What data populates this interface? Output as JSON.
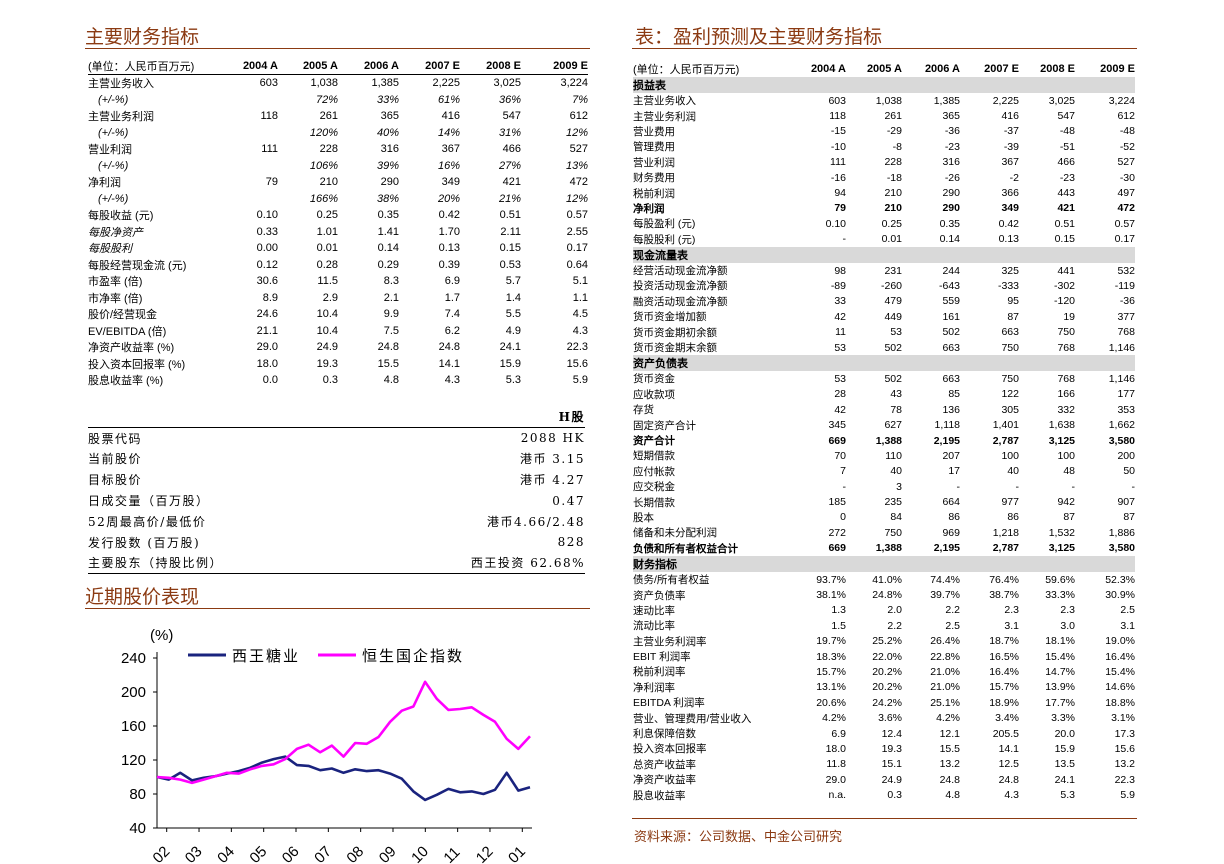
{
  "left": {
    "title": "主要财务指标",
    "table": {
      "unit": "(单位：人民币百万元)",
      "years": [
        "2004 A",
        "2005 A",
        "2006 A",
        "2007 E",
        "2008 E",
        "2009 E"
      ],
      "rows": [
        {
          "label": "主营业务收入",
          "values": [
            "603",
            "1,038",
            "1,385",
            "2,225",
            "3,025",
            "3,224"
          ]
        },
        {
          "label": "(+/-%)",
          "values": [
            "",
            "72%",
            "33%",
            "61%",
            "36%",
            "7%"
          ]
        },
        {
          "label": "主营业务利润",
          "values": [
            "118",
            "261",
            "365",
            "416",
            "547",
            "612"
          ]
        },
        {
          "label": "(+/-%)",
          "values": [
            "",
            "120%",
            "40%",
            "14%",
            "31%",
            "12%"
          ]
        },
        {
          "label": "营业利润",
          "values": [
            "111",
            "228",
            "316",
            "367",
            "466",
            "527"
          ]
        },
        {
          "label": "(+/-%)",
          "values": [
            "",
            "106%",
            "39%",
            "16%",
            "27%",
            "13%"
          ]
        },
        {
          "label": "净利润",
          "values": [
            "79",
            "210",
            "290",
            "349",
            "421",
            "472"
          ]
        },
        {
          "label": "(+/-%)",
          "values": [
            "",
            "166%",
            "38%",
            "20%",
            "21%",
            "12%"
          ]
        },
        {
          "label": "每股收益 (元)",
          "values": [
            "0.10",
            "0.25",
            "0.35",
            "0.42",
            "0.51",
            "0.57"
          ]
        },
        {
          "label": "每股净资产",
          "values": [
            "0.33",
            "1.01",
            "1.41",
            "1.70",
            "2.11",
            "2.55"
          ]
        },
        {
          "label": "每股股利",
          "values": [
            "0.00",
            "0.01",
            "0.14",
            "0.13",
            "0.15",
            "0.17"
          ]
        },
        {
          "label": "每股经营现金流 (元)",
          "values": [
            "0.12",
            "0.28",
            "0.29",
            "0.39",
            "0.53",
            "0.64"
          ]
        },
        {
          "label": "市盈率 (倍)",
          "values": [
            "30.6",
            "11.5",
            "8.3",
            "6.9",
            "5.7",
            "5.1"
          ]
        },
        {
          "label": "市净率 (倍)",
          "values": [
            "8.9",
            "2.9",
            "2.1",
            "1.7",
            "1.4",
            "1.1"
          ]
        },
        {
          "label": "股价/经营现金",
          "values": [
            "24.6",
            "10.4",
            "9.9",
            "7.4",
            "5.5",
            "4.5"
          ]
        },
        {
          "label": "EV/EBITDA (倍)",
          "values": [
            "21.1",
            "10.4",
            "7.5",
            "6.2",
            "4.9",
            "4.3"
          ]
        },
        {
          "label": "净资产收益率 (%)",
          "values": [
            "29.0",
            "24.9",
            "24.8",
            "24.8",
            "24.1",
            "22.3"
          ]
        },
        {
          "label": "投入资本回报率 (%)",
          "values": [
            "18.0",
            "19.3",
            "15.5",
            "14.1",
            "15.9",
            "15.6"
          ]
        },
        {
          "label": "股息收益率 (%)",
          "values": [
            "0.0",
            "0.3",
            "4.8",
            "4.3",
            "5.3",
            "5.9"
          ]
        }
      ]
    },
    "stock": {
      "header": "H股",
      "rows": [
        {
          "label": "股票代码",
          "value": "2088 HK"
        },
        {
          "label": "当前股价",
          "value": "港币 3.15"
        },
        {
          "label": "目标股价",
          "value": "港币 4.27"
        },
        {
          "label": "日成交量（百万股）",
          "value": "0.47"
        },
        {
          "label": "52周最高价/最低价",
          "value": "港币4.66/2.48"
        },
        {
          "label": "发行股数 (百万股)",
          "value": "828"
        },
        {
          "label": "主要股东（持股比例）",
          "value": "西王投资 62.68%"
        }
      ]
    },
    "chart_title": "近期股价表现"
  },
  "chart_data": {
    "type": "line",
    "ylabel": "(%)",
    "ylim": [
      40,
      240
    ],
    "yticks": [
      40,
      80,
      120,
      160,
      200,
      240
    ],
    "xticks": [
      "02",
      "03",
      "04",
      "05",
      "06",
      "07",
      "08",
      "09",
      "10",
      "11",
      "12",
      "01"
    ],
    "series": [
      {
        "name": "西王糖业",
        "color": "#1a237e",
        "values": [
          100,
          97,
          105,
          96,
          99,
          101,
          104,
          107,
          111,
          117,
          121,
          124,
          114,
          113,
          108,
          110,
          105,
          109,
          107,
          108,
          104,
          98,
          83,
          73,
          79,
          86,
          82,
          83,
          80,
          85,
          105,
          84,
          88
        ]
      },
      {
        "name": "恒生国企指数",
        "color": "#ff00ff",
        "values": [
          100,
          99,
          97,
          93,
          97,
          101,
          105,
          104,
          109,
          113,
          115,
          121,
          133,
          138,
          129,
          137,
          124,
          140,
          139,
          147,
          165,
          178,
          183,
          212,
          192,
          179,
          180,
          182,
          173,
          165,
          145,
          133,
          148
        ]
      }
    ]
  },
  "right": {
    "title": "表：盈利预测及主要财务指标",
    "unit": "(单位：人民币百万元)",
    "years": [
      "2004 A",
      "2005 A",
      "2006 A",
      "2007 E",
      "2008 E",
      "2009 E"
    ],
    "rows": [
      {
        "kind": "band",
        "label": "损益表"
      },
      {
        "label": "主营业务收入",
        "values": [
          "603",
          "1,038",
          "1,385",
          "2,225",
          "3,025",
          "3,224"
        ]
      },
      {
        "label": "主营业务利润",
        "values": [
          "118",
          "261",
          "365",
          "416",
          "547",
          "612"
        ]
      },
      {
        "label": "营业费用",
        "values": [
          "-15",
          "-29",
          "-36",
          "-37",
          "-48",
          "-48"
        ]
      },
      {
        "label": "管理费用",
        "values": [
          "-10",
          "-8",
          "-23",
          "-39",
          "-51",
          "-52"
        ]
      },
      {
        "label": "营业利润",
        "values": [
          "111",
          "228",
          "316",
          "367",
          "466",
          "527"
        ]
      },
      {
        "label": "财务费用",
        "values": [
          "-16",
          "-18",
          "-26",
          "-2",
          "-23",
          "-30"
        ]
      },
      {
        "label": "税前利润",
        "values": [
          "94",
          "210",
          "290",
          "366",
          "443",
          "497"
        ]
      },
      {
        "label": "净利润",
        "bold": true,
        "values": [
          "79",
          "210",
          "290",
          "349",
          "421",
          "472"
        ]
      },
      {
        "label": "每股盈利 (元)",
        "values": [
          "0.10",
          "0.25",
          "0.35",
          "0.42",
          "0.51",
          "0.57"
        ]
      },
      {
        "label": "每股股利 (元)",
        "values": [
          "-",
          "0.01",
          "0.14",
          "0.13",
          "0.15",
          "0.17"
        ]
      },
      {
        "kind": "band",
        "label": "现金流量表"
      },
      {
        "label": "经营活动现金流净额",
        "values": [
          "98",
          "231",
          "244",
          "325",
          "441",
          "532"
        ]
      },
      {
        "label": "投资活动现金流净额",
        "values": [
          "-89",
          "-260",
          "-643",
          "-333",
          "-302",
          "-119"
        ]
      },
      {
        "label": "融资活动现金流净额",
        "values": [
          "33",
          "479",
          "559",
          "95",
          "-120",
          "-36"
        ]
      },
      {
        "label": "货币资金增加额",
        "values": [
          "42",
          "449",
          "161",
          "87",
          "19",
          "377"
        ]
      },
      {
        "label": "货币资金期初余额",
        "values": [
          "11",
          "53",
          "502",
          "663",
          "750",
          "768"
        ]
      },
      {
        "label": "货币资金期末余额",
        "values": [
          "53",
          "502",
          "663",
          "750",
          "768",
          "1,146"
        ]
      },
      {
        "kind": "band",
        "label": "资产负债表"
      },
      {
        "label": "货币资金",
        "values": [
          "53",
          "502",
          "663",
          "750",
          "768",
          "1,146"
        ]
      },
      {
        "label": "应收款项",
        "values": [
          "28",
          "43",
          "85",
          "122",
          "166",
          "177"
        ]
      },
      {
        "label": "存货",
        "values": [
          "42",
          "78",
          "136",
          "305",
          "332",
          "353"
        ]
      },
      {
        "label": "固定资产合计",
        "values": [
          "345",
          "627",
          "1,118",
          "1,401",
          "1,638",
          "1,662"
        ]
      },
      {
        "label": "资产合计",
        "bold": true,
        "values": [
          "669",
          "1,388",
          "2,195",
          "2,787",
          "3,125",
          "3,580"
        ]
      },
      {
        "label": "短期借款",
        "values": [
          "70",
          "110",
          "207",
          "100",
          "100",
          "200"
        ]
      },
      {
        "label": "应付帐款",
        "values": [
          "7",
          "40",
          "17",
          "40",
          "48",
          "50"
        ]
      },
      {
        "label": "应交税金",
        "values": [
          "-",
          "3",
          "-",
          "-",
          "-",
          "-"
        ]
      },
      {
        "label": "长期借款",
        "values": [
          "185",
          "235",
          "664",
          "977",
          "942",
          "907"
        ]
      },
      {
        "label": "股本",
        "values": [
          "0",
          "84",
          "86",
          "86",
          "87",
          "87"
        ]
      },
      {
        "label": "储备和未分配利润",
        "values": [
          "272",
          "750",
          "969",
          "1,218",
          "1,532",
          "1,886"
        ]
      },
      {
        "label": "负债和所有者权益合计",
        "bold": true,
        "values": [
          "669",
          "1,388",
          "2,195",
          "2,787",
          "3,125",
          "3,580"
        ]
      },
      {
        "kind": "band",
        "label": "财务指标"
      },
      {
        "label": "债务/所有者权益",
        "values": [
          "93.7%",
          "41.0%",
          "74.4%",
          "76.4%",
          "59.6%",
          "52.3%"
        ]
      },
      {
        "label": "资产负债率",
        "values": [
          "38.1%",
          "24.8%",
          "39.7%",
          "38.7%",
          "33.3%",
          "30.9%"
        ]
      },
      {
        "label": "速动比率",
        "values": [
          "1.3",
          "2.0",
          "2.2",
          "2.3",
          "2.3",
          "2.5"
        ]
      },
      {
        "label": "流动比率",
        "values": [
          "1.5",
          "2.2",
          "2.5",
          "3.1",
          "3.0",
          "3.1"
        ]
      },
      {
        "label": "主营业务利润率",
        "values": [
          "19.7%",
          "25.2%",
          "26.4%",
          "18.7%",
          "18.1%",
          "19.0%"
        ]
      },
      {
        "label": "EBIT 利润率",
        "values": [
          "18.3%",
          "22.0%",
          "22.8%",
          "16.5%",
          "15.4%",
          "16.4%"
        ]
      },
      {
        "label": "税前利润率",
        "values": [
          "15.7%",
          "20.2%",
          "21.0%",
          "16.4%",
          "14.7%",
          "15.4%"
        ]
      },
      {
        "label": "净利润率",
        "values": [
          "13.1%",
          "20.2%",
          "21.0%",
          "15.7%",
          "13.9%",
          "14.6%"
        ]
      },
      {
        "label": "EBITDA 利润率",
        "values": [
          "20.6%",
          "24.2%",
          "25.1%",
          "18.9%",
          "17.7%",
          "18.8%"
        ]
      },
      {
        "label": "营业、管理费用/营业收入",
        "values": [
          "4.2%",
          "3.6%",
          "4.2%",
          "3.4%",
          "3.3%",
          "3.1%"
        ]
      },
      {
        "label": "利息保障倍数",
        "values": [
          "6.9",
          "12.4",
          "12.1",
          "205.5",
          "20.0",
          "17.3"
        ]
      },
      {
        "label": "投入资本回报率",
        "values": [
          "18.0",
          "19.3",
          "15.5",
          "14.1",
          "15.9",
          "15.6"
        ]
      },
      {
        "label": "总资产收益率",
        "values": [
          "11.8",
          "15.1",
          "13.2",
          "12.5",
          "13.5",
          "13.2"
        ]
      },
      {
        "label": "净资产收益率",
        "values": [
          "29.0",
          "24.9",
          "24.8",
          "24.8",
          "24.1",
          "22.3"
        ]
      },
      {
        "label": "股息收益率",
        "values": [
          "n.a.",
          "0.3",
          "4.8",
          "4.3",
          "5.3",
          "5.9"
        ]
      }
    ],
    "source": "资料来源：公司数据、中金公司研究"
  }
}
